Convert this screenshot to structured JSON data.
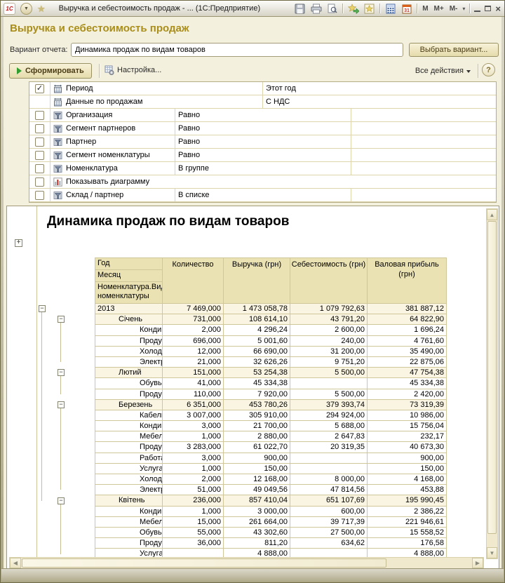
{
  "titlebar": {
    "title": "Выручка и себестоимость продаж - ...  (1С:Предприятие)",
    "logo": "1С",
    "memory_buttons": [
      "M",
      "M+",
      "M-"
    ]
  },
  "header": {
    "page_title": "Выручка и себестоимость продаж",
    "variant_label": "Вариант отчета:",
    "variant_value": "Динамика продаж по видам товаров",
    "choose_variant_button": "Выбрать вариант...",
    "generate_button": "Сформировать",
    "settings_button": "Настройка...",
    "all_actions_button": "Все действия",
    "help_button": "?"
  },
  "filters": {
    "rows": [
      {
        "checkbox": "checked",
        "icon": "period-icon",
        "name": "Период",
        "condition": "",
        "value": "Этот год",
        "layout": "param"
      },
      {
        "checkbox": "none",
        "icon": "period-icon",
        "name": "Данные по продажам",
        "condition": "",
        "value": "С НДС",
        "layout": "param"
      },
      {
        "checkbox": "unchecked",
        "icon": "filter-icon",
        "name": "Организация",
        "condition": "Равно",
        "value": "",
        "layout": "filter"
      },
      {
        "checkbox": "unchecked",
        "icon": "filter-icon",
        "name": "Сегмент партнеров",
        "condition": "Равно",
        "value": "",
        "layout": "filter"
      },
      {
        "checkbox": "unchecked",
        "icon": "filter-icon",
        "name": "Партнер",
        "condition": "Равно",
        "value": "",
        "layout": "filter"
      },
      {
        "checkbox": "unchecked",
        "icon": "filter-icon",
        "name": "Сегмент номенклатуры",
        "condition": "Равно",
        "value": "",
        "layout": "filter"
      },
      {
        "checkbox": "unchecked",
        "icon": "filter-icon",
        "name": "Номенклатура",
        "condition": "В группе",
        "value": "",
        "layout": "filter"
      },
      {
        "checkbox": "unchecked",
        "icon": "chart-icon",
        "name": "Показывать диаграмму",
        "condition": "",
        "value": "",
        "layout": "flag"
      },
      {
        "checkbox": "unchecked",
        "icon": "filter-icon",
        "name": "Склад / партнер",
        "condition": "В списке",
        "value": "",
        "layout": "filter"
      }
    ]
  },
  "report": {
    "title": "Динамика продаж по видам товаров",
    "row_headers": [
      "Год",
      "Месяц",
      "Номенклатура.Вид номенклатуры"
    ],
    "columns": [
      "Количество",
      "Выручка (грн)",
      "Себестоимость (грн)",
      "Валовая прибыль (грн)"
    ],
    "rows": [
      {
        "label": "2013",
        "level": 0,
        "group": true,
        "qty": "7 469,000",
        "revenue": "1 473 058,78",
        "cost": "1 079 792,63",
        "profit": "381 887,12"
      },
      {
        "label": "Січень",
        "level": 1,
        "group": true,
        "qty": "731,000",
        "revenue": "108 614,10",
        "cost": "43 791,20",
        "profit": "64 822,90"
      },
      {
        "label": "Кондиционеры",
        "level": 2,
        "group": false,
        "qty": "2,000",
        "revenue": "4 296,24",
        "cost": "2 600,00",
        "profit": "1 696,24"
      },
      {
        "label": "Продукты",
        "level": 2,
        "group": false,
        "qty": "696,000",
        "revenue": "5 001,60",
        "cost": "240,00",
        "profit": "4 761,60"
      },
      {
        "label": "Холодильники",
        "level": 2,
        "group": false,
        "qty": "12,000",
        "revenue": "66 690,00",
        "cost": "31 200,00",
        "profit": "35 490,00"
      },
      {
        "label": "Электротовары",
        "level": 2,
        "group": false,
        "qty": "21,000",
        "revenue": "32 626,26",
        "cost": "9 751,20",
        "profit": "22 875,06"
      },
      {
        "label": "Лютий",
        "level": 1,
        "group": true,
        "qty": "151,000",
        "revenue": "53 254,38",
        "cost": "5 500,00",
        "profit": "47 754,38"
      },
      {
        "label": "Обувь",
        "level": 2,
        "group": false,
        "qty": "41,000",
        "revenue": "45 334,38",
        "cost": "",
        "profit": "45 334,38"
      },
      {
        "label": "Продукты",
        "level": 2,
        "group": false,
        "qty": "110,000",
        "revenue": "7 920,00",
        "cost": "5 500,00",
        "profit": "2 420,00"
      },
      {
        "label": "Березень",
        "level": 1,
        "group": true,
        "qty": "6 351,000",
        "revenue": "453 780,26",
        "cost": "379 393,74",
        "profit": "73 319,39"
      },
      {
        "label": "Кабели силовые NYM",
        "level": 2,
        "group": false,
        "qty": "3 007,000",
        "revenue": "305 910,00",
        "cost": "294 924,00",
        "profit": "10 986,00"
      },
      {
        "label": "Кондиционеры",
        "level": 2,
        "group": false,
        "qty": "3,000",
        "revenue": "21 700,00",
        "cost": "5 688,00",
        "profit": "15 756,04"
      },
      {
        "label": "Мебель",
        "level": 2,
        "group": false,
        "qty": "1,000",
        "revenue": "2 880,00",
        "cost": "2 647,83",
        "profit": "232,17"
      },
      {
        "label": "Продукты",
        "level": 2,
        "group": false,
        "qty": "3 283,000",
        "revenue": "61 022,70",
        "cost": "20 319,35",
        "profit": "40 673,30"
      },
      {
        "label": "Работа",
        "level": 2,
        "group": false,
        "qty": "3,000",
        "revenue": "900,00",
        "cost": "",
        "profit": "900,00"
      },
      {
        "label": "Услуга",
        "level": 2,
        "group": false,
        "qty": "1,000",
        "revenue": "150,00",
        "cost": "",
        "profit": "150,00"
      },
      {
        "label": "Холодильники",
        "level": 2,
        "group": false,
        "qty": "2,000",
        "revenue": "12 168,00",
        "cost": "8 000,00",
        "profit": "4 168,00"
      },
      {
        "label": "Электротовары",
        "level": 2,
        "group": false,
        "qty": "51,000",
        "revenue": "49 049,56",
        "cost": "47 814,56",
        "profit": "453,88"
      },
      {
        "label": "Квітень",
        "level": 1,
        "group": true,
        "qty": "236,000",
        "revenue": "857 410,04",
        "cost": "651 107,69",
        "profit": "195 990,45"
      },
      {
        "label": "Кондиционеры",
        "level": 2,
        "group": false,
        "qty": "1,000",
        "revenue": "3 000,00",
        "cost": "600,00",
        "profit": "2 386,22"
      },
      {
        "label": "Мебель",
        "level": 2,
        "group": false,
        "qty": "15,000",
        "revenue": "261 664,00",
        "cost": "39 717,39",
        "profit": "221 946,61"
      },
      {
        "label": "Обувь",
        "level": 2,
        "group": false,
        "qty": "55,000",
        "revenue": "43 302,60",
        "cost": "27 500,00",
        "profit": "15 558,52"
      },
      {
        "label": "Продукты",
        "level": 2,
        "group": false,
        "qty": "36,000",
        "revenue": "811,20",
        "cost": "634,62",
        "profit": "176,58"
      },
      {
        "label": "Услуга",
        "level": 2,
        "group": false,
        "qty": "",
        "revenue": "4 888,00",
        "cost": "",
        "profit": "4 888,00"
      }
    ]
  },
  "colors": {
    "accent_gold": "#a98e1a",
    "header_cell": "#ebe2b4",
    "group_row": "#faf5e2",
    "generate_play": "#2f9e2f"
  }
}
